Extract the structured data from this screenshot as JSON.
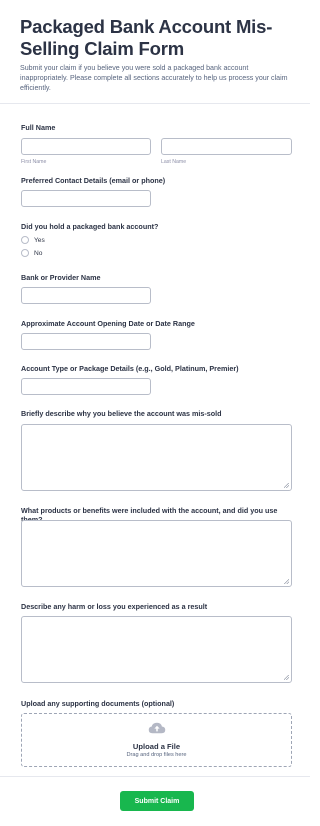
{
  "header": {
    "title": "Packaged Bank Account Mis-Selling Claim Form",
    "subtitle": "Submit your claim if you believe you were sold a packaged bank account inappropriately. Please complete all sections accurately to help us process your claim efficiently."
  },
  "full_name": {
    "label": "Full Name",
    "first_sublabel": "First Name",
    "last_sublabel": "Last Name"
  },
  "contact": {
    "label": "Preferred Contact Details (email or phone)"
  },
  "packaged": {
    "label": "Did you hold a packaged bank account?",
    "options": [
      "Yes",
      "No"
    ]
  },
  "bank": {
    "label": "Bank or Provider Name"
  },
  "opening_date": {
    "label": "Approximate Account Opening Date or Date Range"
  },
  "account_type": {
    "label": "Account Type or Package Details (e.g., Gold, Platinum, Premier)"
  },
  "mis_sold": {
    "label": "Briefly describe why you believe the account was mis-sold"
  },
  "benefits": {
    "label": "What products or benefits were included with the account, and did you use them?"
  },
  "harm": {
    "label": "Describe any harm or loss you experienced as a result"
  },
  "upload": {
    "label": "Upload any supporting documents (optional)",
    "title": "Upload a File",
    "subtitle": "Drag and drop files here",
    "icon": "cloud-upload-icon"
  },
  "submit": {
    "label": "Submit Claim",
    "color": "#18b74e"
  }
}
